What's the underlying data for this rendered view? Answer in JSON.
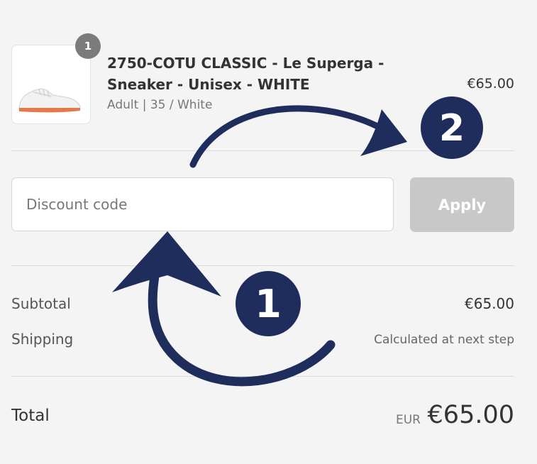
{
  "product": {
    "quantity": "1",
    "title": "2750-COTU CLASSIC - Le Superga - Sneaker - Unisex - WHITE",
    "variant": "Adult | 35 / White",
    "price": "€65.00"
  },
  "discount": {
    "placeholder": "Discount code",
    "value": "",
    "apply_label": "Apply"
  },
  "summary": {
    "subtotal_label": "Subtotal",
    "subtotal_value": "€65.00",
    "shipping_label": "Shipping",
    "shipping_value": "Calculated at next step"
  },
  "total": {
    "label": "Total",
    "currency": "EUR",
    "amount": "€65.00"
  },
  "annotations": {
    "step1": "1",
    "step2": "2",
    "arrow_color": "#1f2d5c"
  }
}
